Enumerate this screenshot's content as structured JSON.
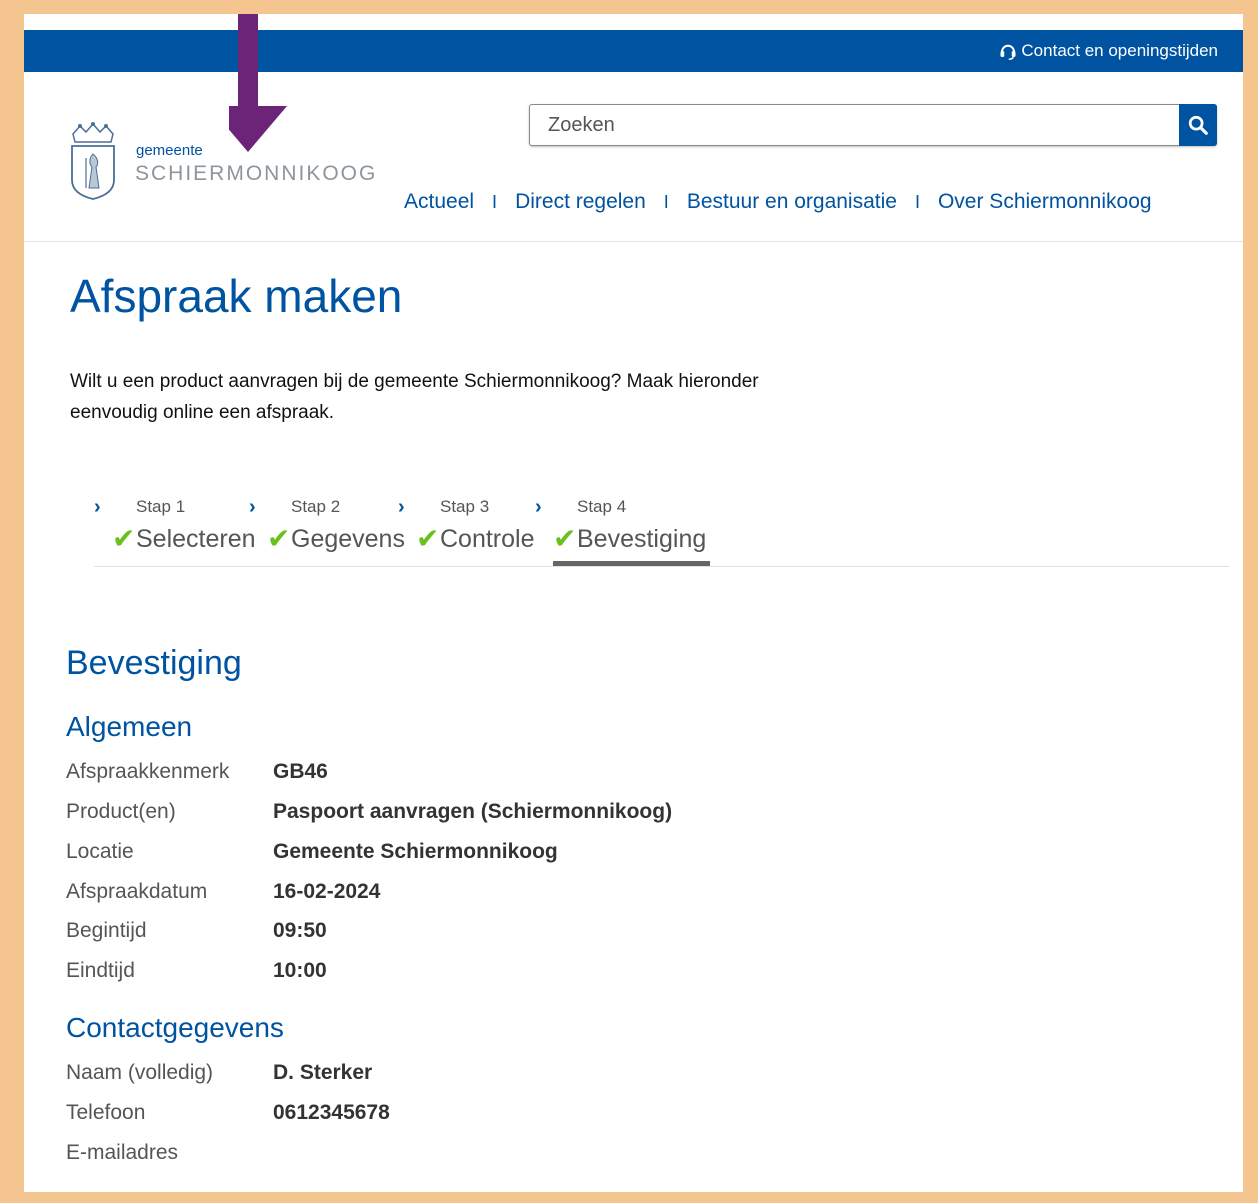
{
  "topbar": {
    "contact_label": "Contact en openingstijden"
  },
  "logo": {
    "small": "gemeente",
    "big": "SCHIERMONNIKOOG"
  },
  "search": {
    "placeholder": "Zoeken"
  },
  "nav": {
    "items": [
      "Actueel",
      "Direct regelen",
      "Bestuur en organisatie",
      "Over Schiermonnikoog"
    ],
    "separator": "I"
  },
  "page": {
    "title": "Afspraak maken",
    "intro": "Wilt u een product aanvragen bij de gemeente Schiermonnikoog? Maak hieronder eenvoudig online een afspraak."
  },
  "steps": [
    {
      "num": "Stap 1",
      "label": "Selecteren"
    },
    {
      "num": "Stap 2",
      "label": "Gegevens"
    },
    {
      "num": "Stap 3",
      "label": "Controle"
    },
    {
      "num": "Stap 4",
      "label": "Bevestiging"
    }
  ],
  "confirmation": {
    "heading": "Bevestiging",
    "general_heading": "Algemeen",
    "general": [
      {
        "k": "Afspraakkenmerk",
        "v": "GB46"
      },
      {
        "k": "Product(en)",
        "v": "Paspoort aanvragen (Schiermonnikoog)"
      },
      {
        "k": "Locatie",
        "v": "Gemeente Schiermonnikoog"
      },
      {
        "k": "Afspraakdatum",
        "v": "16-02-2024"
      },
      {
        "k": "Begintijd",
        "v": "09:50"
      },
      {
        "k": "Eindtijd",
        "v": "10:00"
      }
    ],
    "contact_heading": "Contactgegevens",
    "contact": [
      {
        "k": "Naam (volledig)",
        "v": "D. Sterker"
      },
      {
        "k": "Telefoon",
        "v": "0612345678"
      },
      {
        "k": "E-mailadres",
        "v": ""
      }
    ]
  },
  "colors": {
    "brand": "#0053a1",
    "frame": "#f5c58f",
    "check": "#6bbf1e",
    "arrow": "#6b2477"
  },
  "icons": {
    "contact": "headset-icon",
    "search": "search-icon",
    "step_chevron": "chevron-right-icon",
    "step_check": "check-icon",
    "annotation": "down-arrow-icon"
  }
}
